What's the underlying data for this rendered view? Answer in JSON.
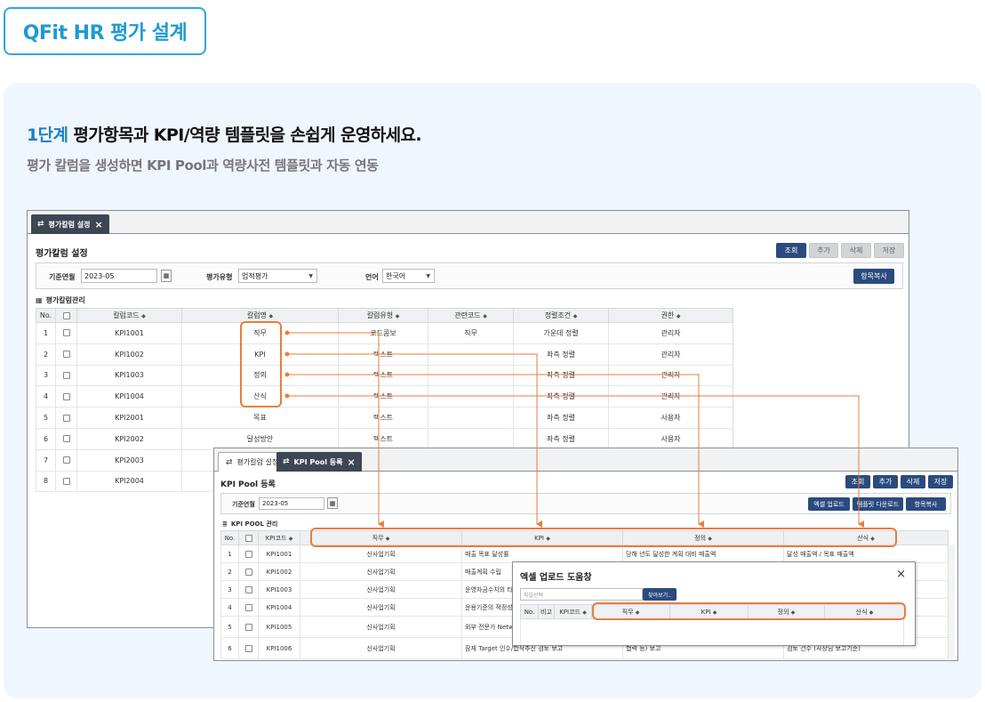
{
  "badge": {
    "label": "QFit HR 평가 설계"
  },
  "headline": {
    "step": "1단계",
    "text": "평가항목과 KPI/역량 템플릿을 손쉽게 운영하세요."
  },
  "subline": "평가 칼럼을 생성하면 KPI Pool과 역량사전 템플릿과 자동 연동",
  "colors": {
    "accent": "#1d7fc4",
    "highlight": "#ea7d3c",
    "navy_button": "#2b4a7e",
    "panel_bg": "#f0f6fd"
  },
  "window1": {
    "tab": "평가칼럼 설정",
    "title": "평가칼럼 설정",
    "buttons": {
      "search": "조회",
      "add": "추가",
      "delete": "삭제",
      "save": "저장",
      "copy": "항목복사"
    },
    "filters": {
      "base_month_label": "기준연월",
      "base_month": "2023-05",
      "eval_type_label": "평가유형",
      "eval_type": "업적평가",
      "language_label": "언어",
      "language": "한국어"
    },
    "section": "평가칼럼관리",
    "columns": [
      "No.",
      "",
      "칼럼코드",
      "칼럼명",
      "칼럼유형",
      "관련코드",
      "정렬조건",
      "권한"
    ],
    "rows": [
      {
        "no": "1",
        "code": "KPI1001",
        "name": "직무",
        "type": "코드콤보",
        "related": "직무",
        "align": "가운데 정렬",
        "auth": "관리자"
      },
      {
        "no": "2",
        "code": "KPI1002",
        "name": "KPI",
        "type": "텍스트",
        "related": "",
        "align": "좌측 정렬",
        "auth": "관리자"
      },
      {
        "no": "3",
        "code": "KPI1003",
        "name": "정의",
        "type": "텍스트",
        "related": "",
        "align": "좌측 정렬",
        "auth": "관리자"
      },
      {
        "no": "4",
        "code": "KPI1004",
        "name": "산식",
        "type": "텍스트",
        "related": "",
        "align": "좌측 정렬",
        "auth": "관리자"
      },
      {
        "no": "5",
        "code": "KPI2001",
        "name": "목표",
        "type": "텍스트",
        "related": "",
        "align": "좌측 정렬",
        "auth": "사용자"
      },
      {
        "no": "6",
        "code": "KPI2002",
        "name": "달성방안",
        "type": "텍스트",
        "related": "",
        "align": "좌측 정렬",
        "auth": "사용자"
      },
      {
        "no": "7",
        "code": "KPI2003",
        "name": "",
        "type": "",
        "related": "",
        "align": "",
        "auth": ""
      },
      {
        "no": "8",
        "code": "KPI2004",
        "name": "",
        "type": "",
        "related": "",
        "align": "",
        "auth": ""
      }
    ]
  },
  "window2": {
    "tabs": [
      "평가칼럼 설정",
      "KPI Pool 등록"
    ],
    "title": "KPI Pool 등록",
    "buttons": {
      "search": "조회",
      "add": "추가",
      "delete": "삭제",
      "save": "저장",
      "excel_upload": "엑셀 업로드",
      "template_download": "템플릿 다운로드",
      "copy": "항목복사"
    },
    "filters": {
      "base_month_label": "기준연월",
      "base_month": "2023-05"
    },
    "section": "KPI POOL 관리",
    "columns": [
      "No.",
      "",
      "KPI코드",
      "직무",
      "KPI",
      "정의",
      "산식"
    ],
    "rows": [
      {
        "no": "1",
        "code": "KPI1001",
        "job": "신사업기획",
        "kpi": "매출 목표 달성률",
        "def": "당해 년도 달성한 계획 대비 매출액",
        "formula": "달성 매출액 / 목표 매출액"
      },
      {
        "no": "2",
        "code": "KPI1002",
        "job": "신사업기획",
        "kpi": "매출계획 수립",
        "def": "",
        "formula": ""
      },
      {
        "no": "3",
        "code": "KPI1003",
        "job": "신사업기획",
        "kpi": "운영자금수치의 타",
        "def": "",
        "formula": ""
      },
      {
        "no": "4",
        "code": "KPI1004",
        "job": "신사업기획",
        "kpi": "운용기준의 적정성",
        "def": "",
        "formula": ""
      },
      {
        "no": "5",
        "code": "KPI1005",
        "job": "신사업기획",
        "kpi": "외부 전문가 Netw",
        "def": "",
        "formula": ""
      },
      {
        "no": "6",
        "code": "KPI1006",
        "job": "신사업기획",
        "kpi": "잠재 Target 인수/합작추진 검토 보고",
        "def": "협력 등) 보고",
        "formula": "검토 건수 (사장님 보고기준)"
      }
    ]
  },
  "popup": {
    "title": "엑셀 업로드 도움창",
    "file_placeholder": "파일선택",
    "browse": "찾아보기..",
    "columns": [
      "No.",
      "비고",
      "KPI코드",
      "직무",
      "KPI",
      "정의",
      "산식"
    ]
  }
}
